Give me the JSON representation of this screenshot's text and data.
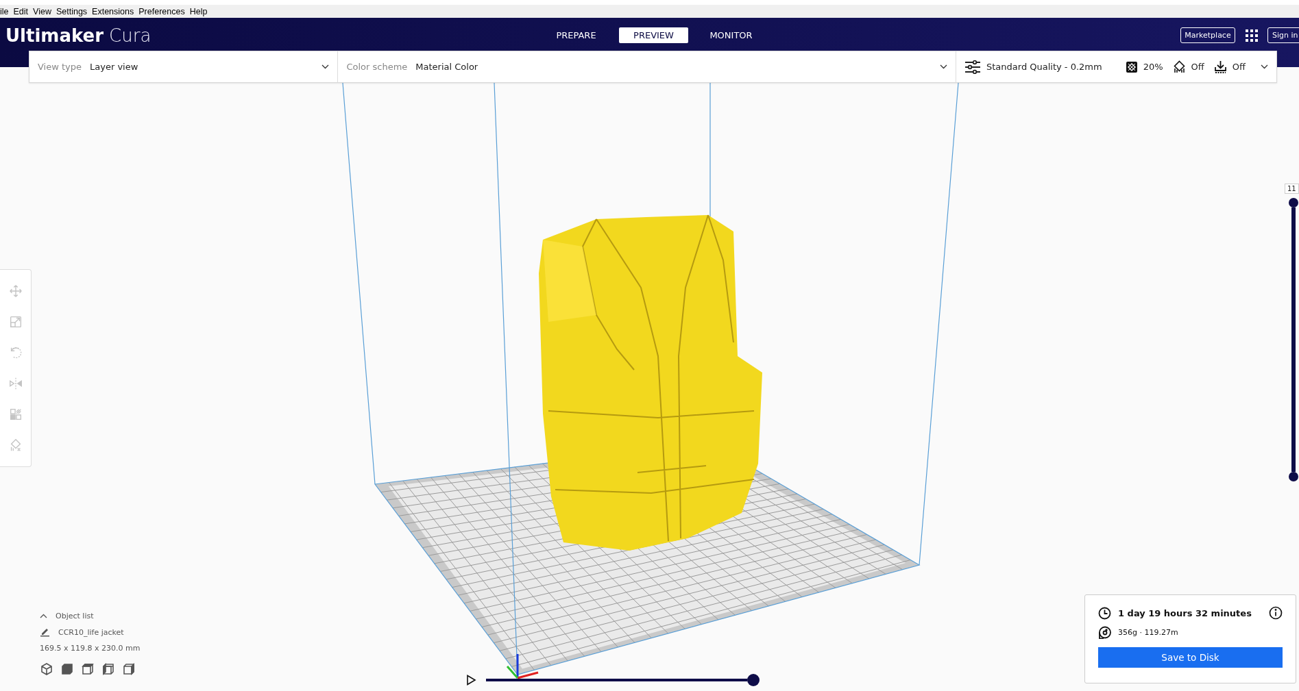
{
  "menu_bar": [
    "ile",
    "Edit",
    "View",
    "Settings",
    "Extensions",
    "Preferences",
    "Help"
  ],
  "header": {
    "logo": {
      "brand": "Ultimaker",
      "product": "Cura"
    },
    "stages": [
      {
        "label": "PREPARE",
        "selected": false
      },
      {
        "label": "PREVIEW",
        "selected": true
      },
      {
        "label": "MONITOR",
        "selected": false
      }
    ],
    "marketplace": "Marketplace",
    "sign_in": "Sign in"
  },
  "view_toolbar": {
    "view_type": {
      "label": "View type",
      "value": "Layer view"
    },
    "color_scheme": {
      "label": "Color scheme",
      "value": "Material Color"
    },
    "print_settings": {
      "profile": "Standard Quality - 0.2mm",
      "infill": "20%",
      "support": "Off",
      "adhesion": "Off"
    }
  },
  "tools": [
    {
      "kind": "move",
      "disabled": true
    },
    {
      "kind": "scale",
      "disabled": true
    },
    {
      "kind": "rotate",
      "disabled": true
    },
    {
      "kind": "mirror",
      "disabled": true
    },
    {
      "kind": "per_model",
      "disabled": true
    },
    {
      "kind": "support_blocker",
      "disabled": true
    }
  ],
  "layer_slider": {
    "reading": "11",
    "level": 1
  },
  "object_list": {
    "title": "Object list",
    "object_name": "CCR10_life jacket",
    "dimensions": "169.5 x 119.8 x 230.0 mm"
  },
  "simulation": {
    "level": 1
  },
  "print_summary": {
    "time": "1 day 19 hours 32 minutes",
    "material": "356g · 119.27m",
    "button": "Save to Disk"
  }
}
